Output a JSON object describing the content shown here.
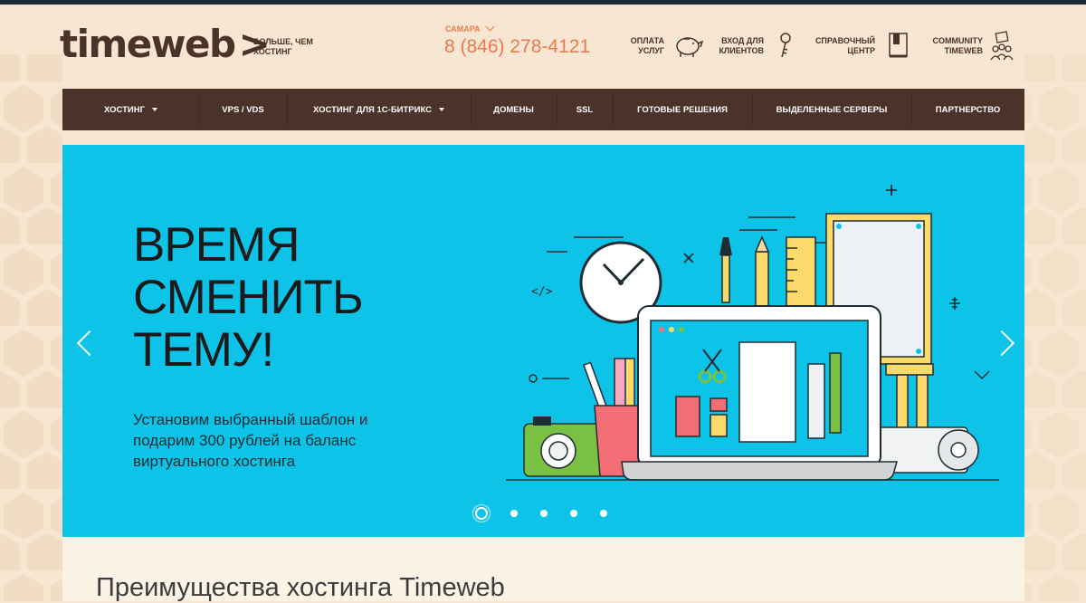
{
  "logo": {
    "text": "timeweb",
    "arrow": ">"
  },
  "tagline": {
    "line1": "БОЛЬШЕ, ЧЕМ",
    "line2": "ХОСТИНГ"
  },
  "city": "САМАРА",
  "phone": "8 (846) 278-4121",
  "header_links": [
    {
      "line1": "ОПЛАТА",
      "line2": "УСЛУГ",
      "icon": "piggy-bank-icon"
    },
    {
      "line1": "ВХОД ДЛЯ",
      "line2": "КЛИЕНТОВ",
      "icon": "key-icon"
    },
    {
      "line1": "СПРАВОЧНЫЙ",
      "line2": "ЦЕНТР",
      "icon": "book-icon"
    },
    {
      "line1": "COMMUNITY",
      "line2": "TIMEWEB",
      "icon": "community-icon"
    }
  ],
  "nav": [
    {
      "label": "ХОСТИНГ",
      "dropdown": true
    },
    {
      "label": "VPS / VDS",
      "dropdown": false
    },
    {
      "label": "ХОСТИНГ ДЛЯ 1С-БИТРИКС",
      "dropdown": true
    },
    {
      "label": "ДОМЕНЫ",
      "dropdown": false
    },
    {
      "label": "SSL",
      "dropdown": false
    },
    {
      "label": "ГОТОВЫЕ РЕШЕНИЯ",
      "dropdown": false
    },
    {
      "label": "ВЫДЕЛЕННЫЕ СЕРВЕРЫ",
      "dropdown": false
    },
    {
      "label": "ПАРТНЕРСТВО",
      "dropdown": false
    }
  ],
  "hero": {
    "title_lines": [
      "ВРЕМЯ",
      "СМЕНИТЬ",
      "ТЕМУ!"
    ],
    "text": "Установим выбранный шаблон и подарим 300 рублей на баланс виртуального хостинга",
    "slide_count": 5,
    "active_slide": 1
  },
  "section_title": "Преимущества хостинга Timeweb",
  "colors": {
    "brand_brown": "#4b322b",
    "accent_orange": "#e97a4f",
    "hero_blue": "#0ec3e8",
    "page_bg": "#f6e6d2"
  }
}
